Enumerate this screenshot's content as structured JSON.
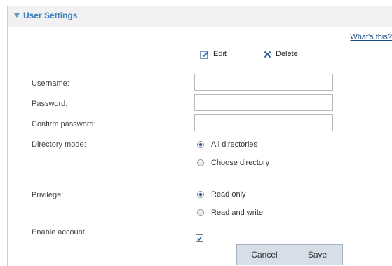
{
  "panel": {
    "title": "User Settings",
    "help_link": "What's this?"
  },
  "toolbar": {
    "edit_label": "Edit",
    "delete_label": "Delete"
  },
  "form": {
    "username_label": "Username:",
    "username_value": "",
    "password_label": "Password:",
    "password_value": "",
    "confirm_label": "Confirm password:",
    "confirm_value": "",
    "directory_label": "Directory mode:",
    "directory_options": [
      "All directories",
      "Choose directory"
    ],
    "directory_selected": "All directories",
    "privilege_label": "Privilege:",
    "privilege_options": [
      "Read only",
      "Read and write"
    ],
    "privilege_selected": "Read only",
    "enable_label": "Enable account:",
    "enable_checked": true
  },
  "actions": {
    "cancel_label": "Cancel",
    "save_label": "Save"
  },
  "colors": {
    "title": "#3d7fc0",
    "header_bg": "#f1f1f1",
    "button_bg": "#d6dfe7",
    "radio_dot": "#1f4e9c"
  }
}
